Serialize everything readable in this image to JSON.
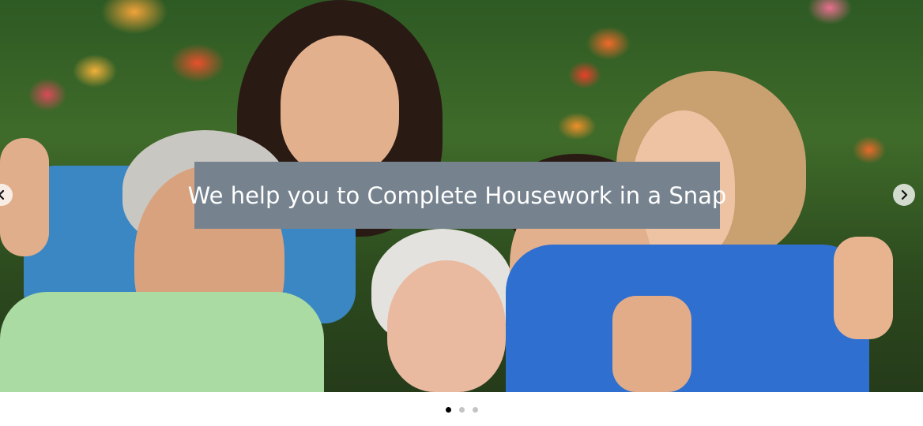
{
  "slider": {
    "caption": "We help you to Complete Housework in a Snap",
    "image_alt": "Caregiver with elderly people giving thumbs up in a garden",
    "prev_icon": "chevron-left-icon",
    "next_icon": "chevron-right-icon",
    "dots": [
      {
        "active": true
      },
      {
        "active": false
      },
      {
        "active": false
      }
    ],
    "colors": {
      "caption_bg": "#76838f",
      "caption_text": "#ffffff",
      "dot_active": "#000000",
      "dot_inactive": "#c4c4c4"
    }
  }
}
